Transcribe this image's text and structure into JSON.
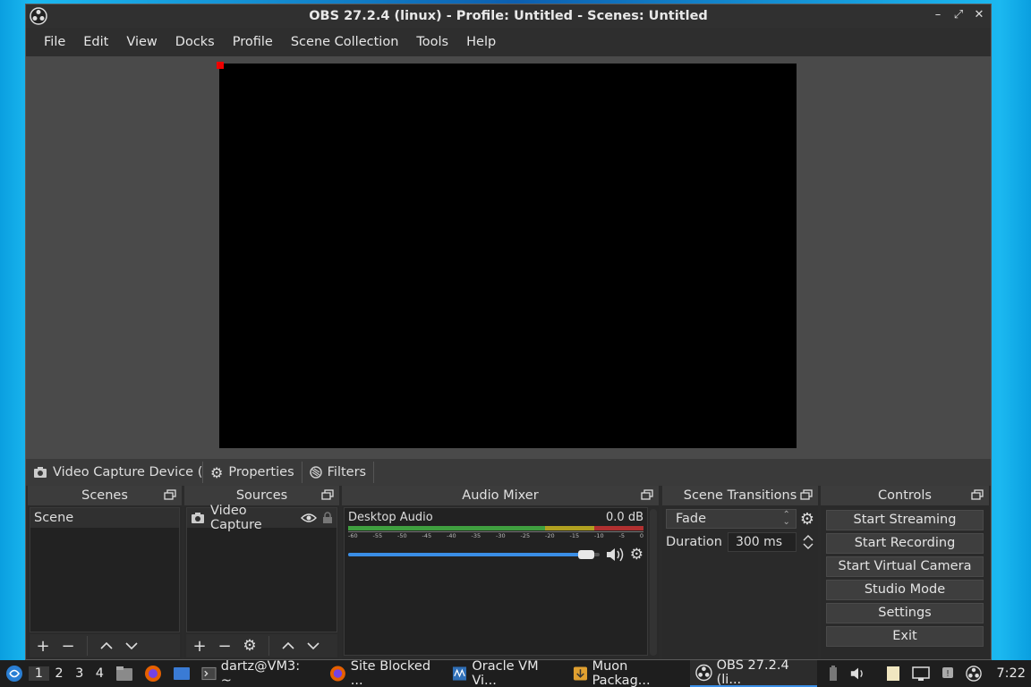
{
  "window": {
    "title": "OBS 27.2.4 (linux) - Profile: Untitled - Scenes: Untitled",
    "controls": [
      "minimize",
      "maximize",
      "close"
    ]
  },
  "menu": [
    "File",
    "Edit",
    "View",
    "Docks",
    "Profile",
    "Scene Collection",
    "Tools",
    "Help"
  ],
  "source_toolbar": {
    "source_name": "Video Capture Device (\\",
    "properties_label": "Properties",
    "filters_label": "Filters"
  },
  "scenes": {
    "title": "Scenes",
    "items": [
      "Scene"
    ]
  },
  "sources": {
    "title": "Sources",
    "items": [
      "Video Capture"
    ]
  },
  "mixer": {
    "title": "Audio Mixer",
    "channel_name": "Desktop Audio",
    "level": "0.0 dB",
    "ticks": [
      "-60",
      "-55",
      "-50",
      "-45",
      "-40",
      "-35",
      "-30",
      "-25",
      "-20",
      "-15",
      "-10",
      "-5",
      "0"
    ],
    "volume_fraction": 0.98
  },
  "transitions": {
    "title": "Scene Transitions",
    "selected": "Fade",
    "duration_label": "Duration",
    "duration_value": "300 ms"
  },
  "controls": {
    "title": "Controls",
    "buttons": [
      "Start Streaming",
      "Start Recording",
      "Start Virtual Camera",
      "Studio Mode",
      "Settings",
      "Exit"
    ]
  },
  "taskbar": {
    "workspaces": [
      "1",
      "2",
      "3",
      "4"
    ],
    "tasks": [
      "dartz@VM3: ~",
      "Site Blocked ...",
      "Oracle VM Vi...",
      "Muon Packag...",
      "OBS 27.2.4 (li..."
    ],
    "clock": "7:22"
  },
  "colors": {
    "accent": "#3a8ee6",
    "meter_green": "#3f9f3f",
    "meter_yellow": "#b0a020",
    "meter_red": "#b03030",
    "handle_red": "#e00000"
  }
}
